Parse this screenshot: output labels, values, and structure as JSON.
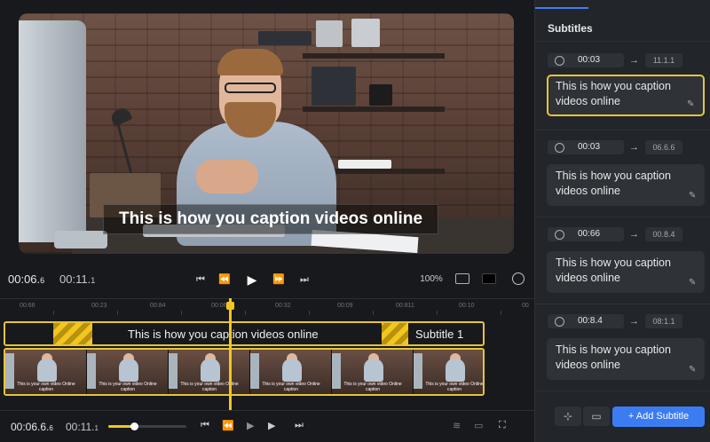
{
  "video": {
    "caption": "This is how you caption videos online"
  },
  "player": {
    "current_time": "00:06.",
    "current_time_frac": "6",
    "duration": "00:11.",
    "duration_frac": "1",
    "zoom": "100%",
    "icons": [
      "skip-back-icon",
      "rewind-icon",
      "play-icon",
      "fast-forward-icon",
      "skip-forward-icon",
      "subtitle-toggle-icon",
      "aspect-icon",
      "globe-icon"
    ]
  },
  "timeline": {
    "ruler": [
      "00:66",
      "00:23",
      "00:84",
      "00:06",
      "00:32",
      "00:09",
      "00:811",
      "00:10",
      "00"
    ],
    "track_caption": "This is how you caption videos online",
    "track_label": "Subtitle 1",
    "thumb_caption": "This is your own video Online caption",
    "thumbs": [
      "This is your own video Online caption",
      "This is your own video Online caption",
      "This is your own video Online caption",
      "This is your own video Online caption",
      "This is your own video Online caption",
      "This is your own video Online caption"
    ]
  },
  "bottom": {
    "current_time": "00:06.6.",
    "current_time_frac": "6",
    "duration": "00:11.",
    "duration_frac": "1",
    "progress": 0.33
  },
  "panel": {
    "title": "Subtitles",
    "subtitles": [
      {
        "start": "00:03",
        "end": "11.1.1",
        "text": "This is how you caption videos online",
        "active": true
      },
      {
        "start": "00:03",
        "end": "06.6.6",
        "text": "This is how you caption videos online",
        "active": false
      },
      {
        "start": "00:66",
        "end": "00.8.4",
        "text": "This is how you caption videos online",
        "active": false
      },
      {
        "start": "00:8.4",
        "end": "08:1.1",
        "text": "This is how you caption videos online",
        "active": false
      }
    ],
    "add_button": "+ Add Subtitle"
  },
  "colors": {
    "accent": "#3b7cf2",
    "highlight": "#e7c43a",
    "background": "#17191d",
    "panel": "#22252a"
  }
}
